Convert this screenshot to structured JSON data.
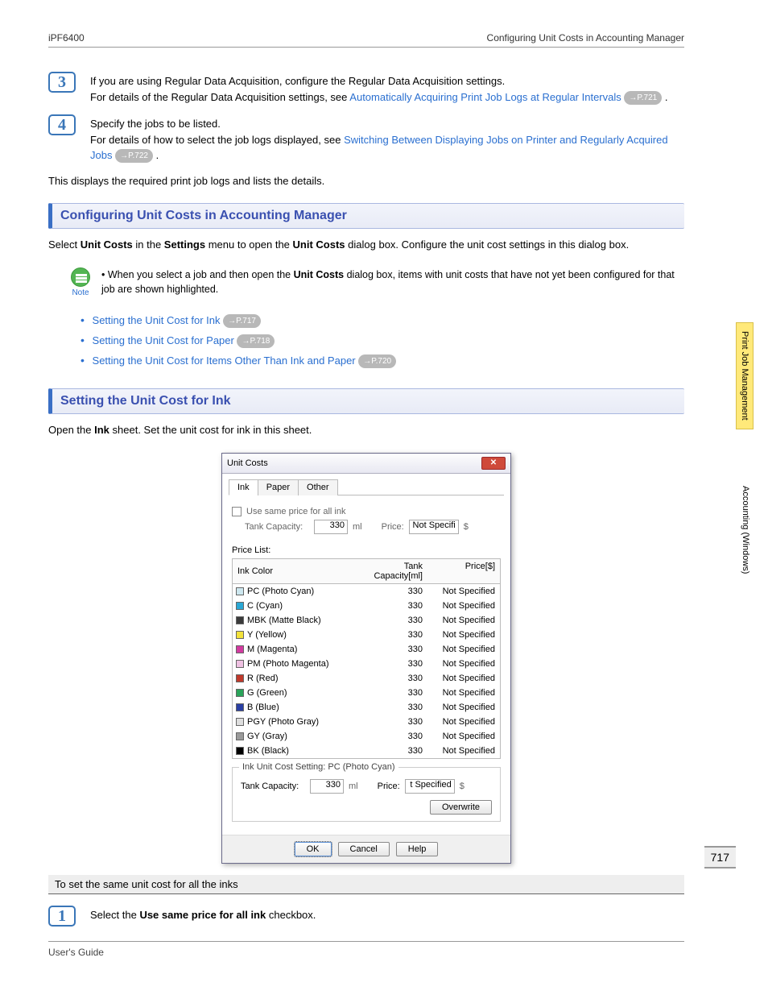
{
  "header": {
    "left": "iPF6400",
    "right": "Configuring Unit Costs in Accounting Manager"
  },
  "side": {
    "tab1": "Print Job Management",
    "tab2": "Accounting (Windows)"
  },
  "page_number": "717",
  "steps": {
    "s3": {
      "num": "3",
      "line1a": "If you are using Regular Data Acquisition, configure the Regular Data Acquisition settings.",
      "line2a": "For details of the Regular Data Acquisition settings, see ",
      "line2link": "Automatically Acquiring Print Job Logs at Regular Intervals",
      "ref": "→P.721",
      "tail": " ."
    },
    "s4": {
      "num": "4",
      "line1": "Specify the jobs to be listed.",
      "line2a": "For details of how to select the job logs displayed, see ",
      "line2link": "Switching Between Displaying Jobs on Printer and Regularly Acquired Jobs",
      "ref": "→P.722",
      "tail": " ."
    },
    "after4": "This displays the required print job logs and lists the details."
  },
  "section1": {
    "title": "Configuring Unit Costs in Accounting Manager",
    "intro_a": "Select ",
    "intro_b": "Unit Costs",
    "intro_c": " in the ",
    "intro_d": "Settings",
    "intro_e": " menu to open the ",
    "intro_f": "Unit Costs",
    "intro_g": " dialog box. Configure the unit cost settings in this dialog box.",
    "note_label": "Note",
    "note_a": "When you select a job and then open the ",
    "note_b": "Unit Costs",
    "note_c": " dialog box, items with unit costs that have not yet been configured for that job are shown highlighted.",
    "bullets": [
      {
        "text": "Setting the Unit Cost for Ink",
        "ref": "→P.717"
      },
      {
        "text": "Setting the Unit Cost for Paper",
        "ref": "→P.718"
      },
      {
        "text": "Setting the Unit Cost for Items Other Than Ink and Paper",
        "ref": "→P.720"
      }
    ]
  },
  "section2": {
    "title": "Setting the Unit Cost for Ink",
    "intro_a": "Open the ",
    "intro_b": "Ink",
    "intro_c": " sheet. Set the unit cost for ink in this sheet."
  },
  "dialog": {
    "title": "Unit Costs",
    "tabs": {
      "ink": "Ink",
      "paper": "Paper",
      "other": "Other"
    },
    "same_price": "Use same price for all ink",
    "tank_capacity_label": "Tank Capacity:",
    "tank_capacity_value": "330",
    "unit_ml": "ml",
    "price_label": "Price:",
    "price_value_top": "Not Specifi",
    "currency": "$",
    "price_list_label": "Price List:",
    "columns": {
      "color": "Ink Color",
      "cap": "Tank Capacity[ml]",
      "price": "Price[$]"
    },
    "rows": [
      {
        "swatch": "#cde7ef",
        "name": "PC (Photo Cyan)",
        "cap": "330",
        "price": "Not Specified"
      },
      {
        "swatch": "#2aa7d4",
        "name": "C (Cyan)",
        "cap": "330",
        "price": "Not Specified"
      },
      {
        "swatch": "#3a3a3a",
        "name": "MBK (Matte Black)",
        "cap": "330",
        "price": "Not Specified"
      },
      {
        "swatch": "#f3e23a",
        "name": "Y (Yellow)",
        "cap": "330",
        "price": "Not Specified"
      },
      {
        "swatch": "#d23aa0",
        "name": "M (Magenta)",
        "cap": "330",
        "price": "Not Specified"
      },
      {
        "swatch": "#efc1e2",
        "name": "PM (Photo Magenta)",
        "cap": "330",
        "price": "Not Specified"
      },
      {
        "swatch": "#c0392b",
        "name": "R (Red)",
        "cap": "330",
        "price": "Not Specified"
      },
      {
        "swatch": "#2aa45a",
        "name": "G (Green)",
        "cap": "330",
        "price": "Not Specified"
      },
      {
        "swatch": "#2a3fa4",
        "name": "B (Blue)",
        "cap": "330",
        "price": "Not Specified"
      },
      {
        "swatch": "#dedede",
        "name": "PGY (Photo Gray)",
        "cap": "330",
        "price": "Not Specified"
      },
      {
        "swatch": "#9a9a9a",
        "name": "GY (Gray)",
        "cap": "330",
        "price": "Not Specified"
      },
      {
        "swatch": "#000000",
        "name": "BK (Black)",
        "cap": "330",
        "price": "Not Specified"
      }
    ],
    "group_title": "Ink Unit Cost Setting: PC (Photo Cyan)",
    "bottom_tank_value": "330",
    "bottom_price_value": "t Specified",
    "overwrite": "Overwrite",
    "ok": "OK",
    "cancel": "Cancel",
    "help": "Help"
  },
  "sub_head": "To set the same unit cost for all the inks",
  "step1": {
    "num": "1",
    "a": "Select the ",
    "b": "Use same price for all ink",
    "c": " checkbox."
  },
  "footer": {
    "left": "User's Guide"
  }
}
